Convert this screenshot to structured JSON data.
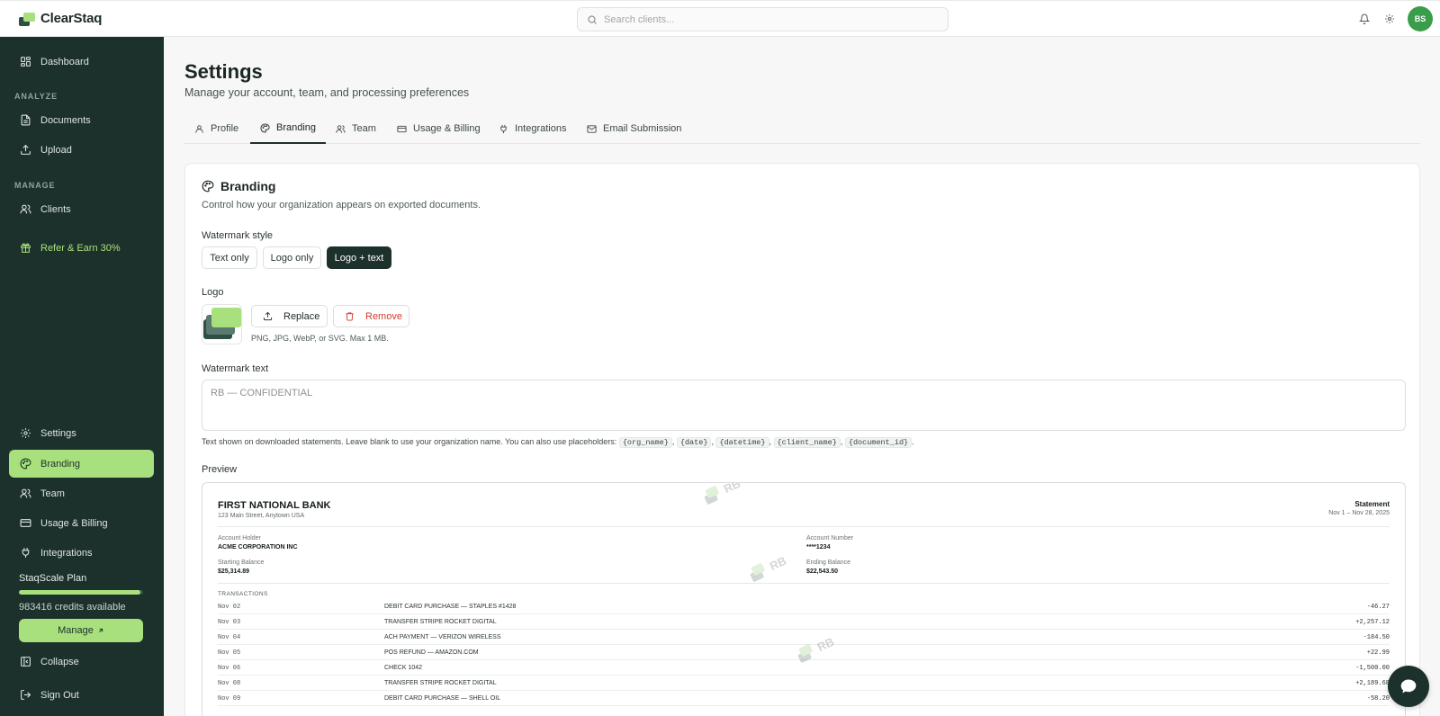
{
  "app": {
    "name": "ClearStaq"
  },
  "search": {
    "placeholder": "Search clients..."
  },
  "user": {
    "initials": "BS"
  },
  "sidebar": {
    "dashboard": "Dashboard",
    "analyze_section": "ANALYZE",
    "documents": "Documents",
    "upload": "Upload",
    "manage_section": "MANAGE",
    "clients": "Clients",
    "refer": "Refer & Earn 30%",
    "settings": "Settings",
    "branding": "Branding",
    "team": "Team",
    "usage_billing": "Usage & Billing",
    "integrations": "Integrations",
    "plan_name": "StaqScale Plan",
    "plan_progress": 0.98,
    "credits": "983416 credits available",
    "manage": "Manage",
    "collapse": "Collapse",
    "sign_out": "Sign Out"
  },
  "page": {
    "title": "Settings",
    "subtitle": "Manage your account, team, and processing preferences"
  },
  "tabs": [
    "Profile",
    "Branding",
    "Team",
    "Usage & Billing",
    "Integrations",
    "Email Submission"
  ],
  "branding": {
    "title": "Branding",
    "description": "Control how your organization appears on exported documents.",
    "watermark_style_label": "Watermark style",
    "styles": [
      "Text only",
      "Logo only",
      "Logo + text"
    ],
    "selected_style": "Logo + text",
    "logo_label": "Logo",
    "replace": "Replace",
    "remove": "Remove",
    "logo_hint": "PNG, JPG, WebP, or SVG. Max 1 MB.",
    "watermark_text_label": "Watermark text",
    "watermark_placeholder": "RB — CONFIDENTIAL",
    "watermark_hint": "Text shown on downloaded statements. Leave blank to use your organization name. You can also use placeholders:",
    "placeholders": [
      "{org_name}",
      "{date}",
      "{datetime}",
      "{client_name}",
      "{document_id}"
    ],
    "preview_label": "Preview"
  },
  "preview": {
    "bank_name": "FIRST NATIONAL BANK",
    "bank_address": "123 Main Street, Anytown USA",
    "statement_label": "Statement",
    "statement_range": "Nov 1 – Nov 28, 2025",
    "account_holder_label": "Account Holder",
    "account_holder": "ACME CORPORATION INC",
    "account_number_label": "Account Number",
    "account_number": "****1234",
    "starting_balance_label": "Starting Balance",
    "starting_balance": "$25,314.89",
    "ending_balance_label": "Ending Balance",
    "ending_balance": "$22,543.50",
    "transactions_label": "TRANSACTIONS",
    "watermark_text": "RB",
    "transactions": [
      {
        "date": "Nov 02",
        "desc": "DEBIT CARD PURCHASE — STAPLES #1428",
        "amount": "-46.27"
      },
      {
        "date": "Nov 03",
        "desc": "TRANSFER STRIPE ROCKET DIGITAL",
        "amount": "+2,257.12"
      },
      {
        "date": "Nov 04",
        "desc": "ACH PAYMENT — VERIZON WIRELESS",
        "amount": "-184.50"
      },
      {
        "date": "Nov 05",
        "desc": "POS REFUND — AMAZON.COM",
        "amount": "+22.99"
      },
      {
        "date": "Nov 06",
        "desc": "CHECK 1042",
        "amount": "-1,500.00"
      },
      {
        "date": "Nov 08",
        "desc": "TRANSFER STRIPE ROCKET DIGITAL",
        "amount": "+2,189.68"
      },
      {
        "date": "Nov 09",
        "desc": "DEBIT CARD PURCHASE — SHELL OIL",
        "amount": "-58.20"
      }
    ]
  },
  "colors": {
    "sidebar_bg": "#1d312c",
    "accent": "#a8e07e",
    "danger": "#d13b2f"
  }
}
